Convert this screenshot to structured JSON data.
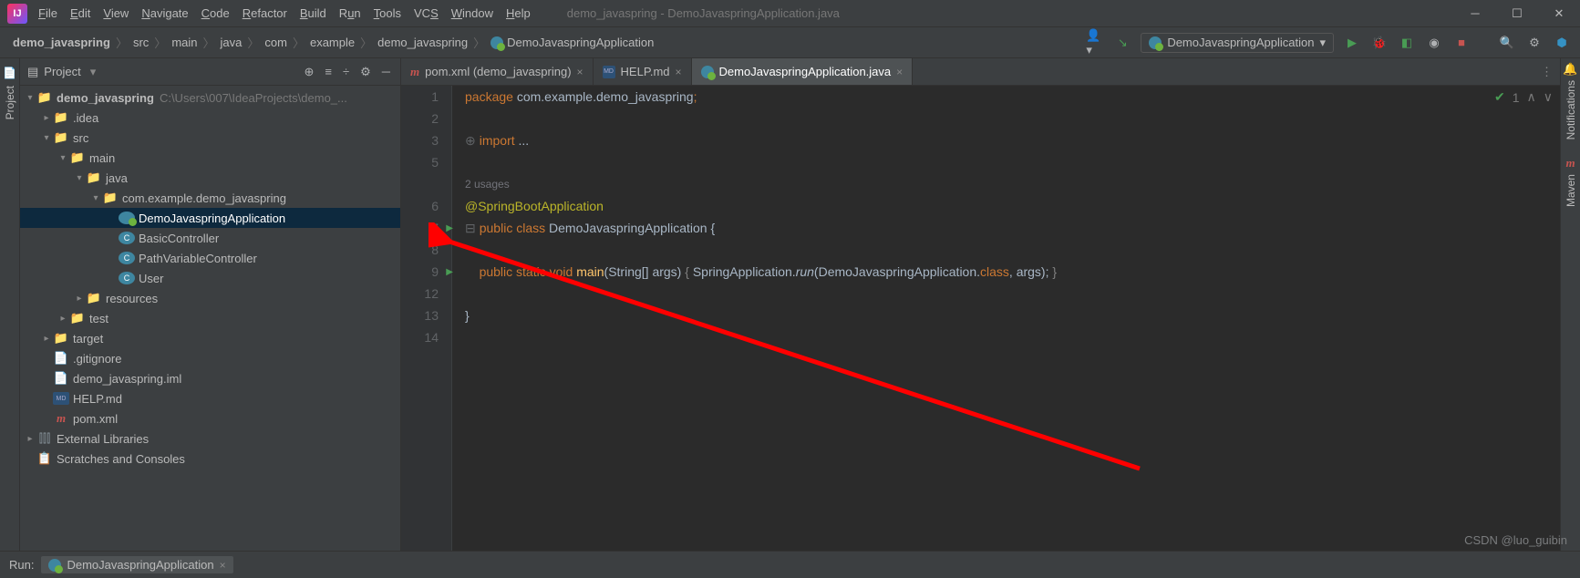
{
  "title": "demo_javaspring - DemoJavaspringApplication.java",
  "menu": [
    "File",
    "Edit",
    "View",
    "Navigate",
    "Code",
    "Refactor",
    "Build",
    "Run",
    "Tools",
    "VCS",
    "Window",
    "Help"
  ],
  "breadcrumb": [
    "demo_javaspring",
    "src",
    "main",
    "java",
    "com",
    "example",
    "demo_javaspring",
    "DemoJavaspringApplication"
  ],
  "runConfig": "DemoJavaspringApplication",
  "projectPanel": {
    "title": "Project"
  },
  "tree": {
    "root": "demo_javaspring",
    "rootPath": "C:\\Users\\007\\IdeaProjects\\demo_...",
    "idea": ".idea",
    "src": "src",
    "main": "main",
    "java": "java",
    "pkg": "com.example.demo_javaspring",
    "app": "DemoJavaspringApplication",
    "basic": "BasicController",
    "pathv": "PathVariableController",
    "user": "User",
    "resources": "resources",
    "test": "test",
    "target": "target",
    "gitignore": ".gitignore",
    "iml": "demo_javaspring.iml",
    "help": "HELP.md",
    "pom": "pom.xml",
    "extlib": "External Libraries",
    "scratch": "Scratches and Consoles"
  },
  "tabs": [
    {
      "label": "pom.xml (demo_javaspring)"
    },
    {
      "label": "HELP.md"
    },
    {
      "label": "DemoJavaspringApplication.java"
    }
  ],
  "lineNumbers": [
    "1",
    "2",
    "3",
    "5",
    "",
    "6",
    "7",
    "8",
    "9",
    "12",
    "13",
    "14"
  ],
  "code": {
    "pkg": "package",
    "pkgName": " com.example.demo_javaspring",
    "semi": ";",
    "imp": "import",
    "ellipsis": " ...",
    "usages": "2 usages",
    "anno": "@SpringBootApplication",
    "pub": "public",
    "cls": " class",
    "clsName": " DemoJavaspring",
    "clsSuffix": "Application ",
    "lbrace": "{",
    "indent": "    ",
    "static": " static",
    "void": " void",
    "main": " main",
    "args": "(String[] args) ",
    "inlineOpen": "{ ",
    "springApp": "SpringApplication.",
    "run": "run",
    "runArgs": "(DemoJavaspringApplication.",
    "classKw": "class",
    "runEnd": ", args); ",
    "inlineClose": "}",
    "rbrace": "}"
  },
  "editorStatus": {
    "problems": "1"
  },
  "bottomBar": {
    "runLabel": "Run:",
    "runTab": "DemoJavaspringApplication"
  },
  "rightTabs": {
    "notifications": "Notifications",
    "maven": "Maven"
  },
  "leftTabs": {
    "project": "Project"
  },
  "watermark": "CSDN @luo_guibin"
}
